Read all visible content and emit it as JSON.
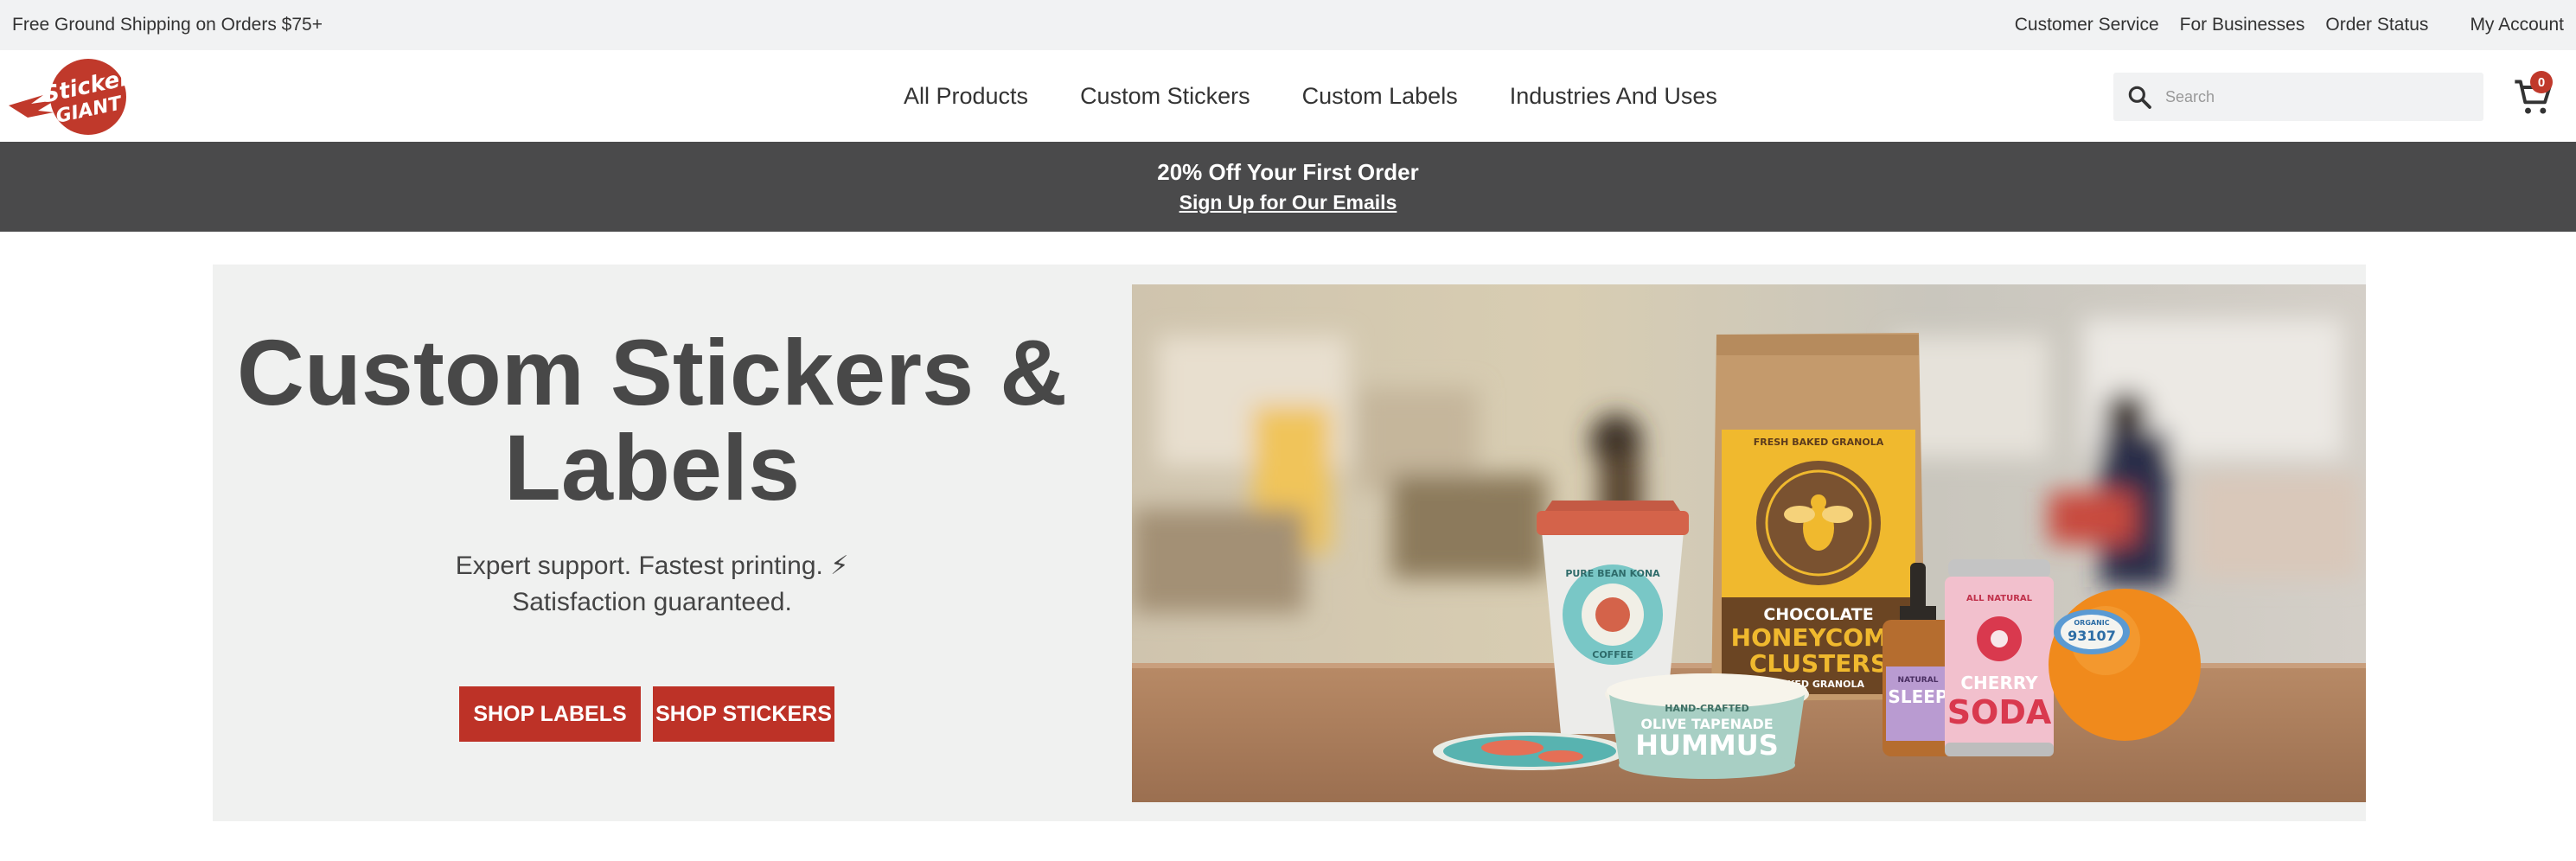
{
  "topbar": {
    "promo": "Free Ground Shipping on Orders $75+",
    "links": [
      "Customer Service",
      "For Businesses",
      "Order Status",
      "My Account"
    ]
  },
  "header": {
    "logo_text_1": "Sticker",
    "logo_text_2": "GIANT",
    "nav": [
      "All Products",
      "Custom Stickers",
      "Custom Labels",
      "Industries And Uses"
    ],
    "search_placeholder": "Search",
    "cart_count": "0"
  },
  "banner": {
    "headline": "20% Off Your First Order",
    "link": "Sign Up for Our Emails"
  },
  "hero": {
    "title_line1": "Custom Stickers &",
    "title_line2": "Labels",
    "subtitle_line1": "Expert support. Fastest printing. ⚡",
    "subtitle_line2": "Satisfaction guaranteed.",
    "btn_labels": "SHOP LABELS",
    "btn_stickers": "SHOP STICKERS",
    "products": {
      "cup_label_1": "PURE BEAN KONA",
      "cup_label_2": "COFFEE",
      "bag_top": "FRESH BAKED GRANOLA",
      "bag_l1": "CHOCOLATE",
      "bag_l2": "HONEYCOMB",
      "bag_l3": "CLUSTERS",
      "bag_l4": "BAKED GRANOLA",
      "tub_top": "HAND-CRAFTED",
      "tub_l1": "OLIVE TAPENADE",
      "tub_l2": "HUMMUS",
      "bottle_l1": "NATURAL",
      "bottle_l2": "SLEEP",
      "can_top": "ALL NATURAL",
      "can_l1": "CHERRY",
      "can_l2": "SODA",
      "orange_l1": "ORGANIC",
      "orange_l2": "93107"
    }
  },
  "colors": {
    "accent": "#bd3227",
    "banner_bg": "#4a4a4b",
    "topbar_bg": "#f1f2f3",
    "hero_bg": "#f0f1f0"
  }
}
